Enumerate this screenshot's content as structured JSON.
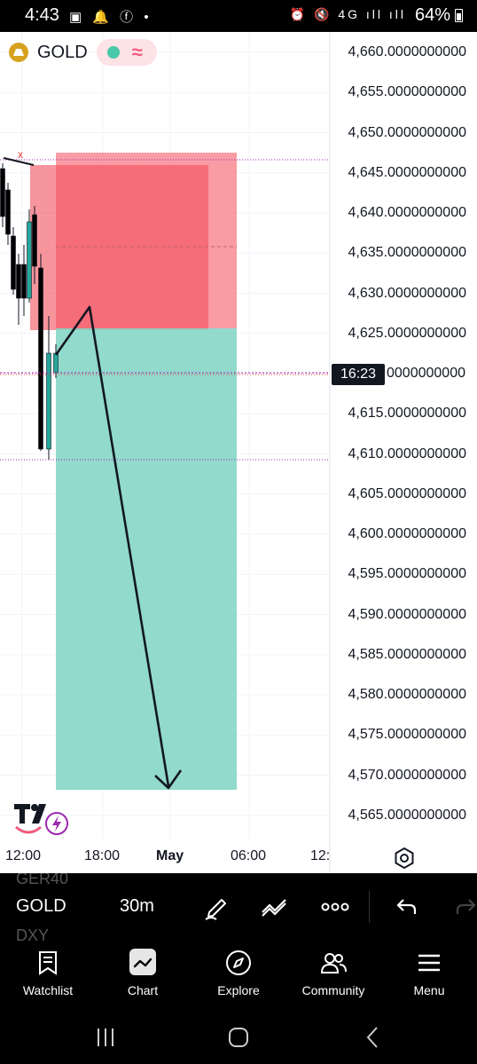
{
  "status_bar": {
    "time": "4:43",
    "left_icons": "▣ 🔔 ⓕ •",
    "right_icons": "⏰ 🔇 4G ıll ıll",
    "battery": "64%"
  },
  "symbol": {
    "name": "GOLD",
    "indicator_symbol": "≈"
  },
  "price_axis": {
    "labels": [
      "4,660.0000000000",
      "4,655.0000000000",
      "4,650.0000000000",
      "4,645.0000000000",
      "4,640.0000000000",
      "4,635.0000000000",
      "4,630.0000000000",
      "4,625.0000000000",
      "4,620.0000000000",
      "4,615.0000000000",
      "4,610.0000000000",
      "4,605.0000000000",
      "4,600.0000000000",
      "4,595.0000000000",
      "4,590.0000000000",
      "4,585.0000000000",
      "4,580.0000000000",
      "4,575.0000000000",
      "4,570.0000000000",
      "4,565.0000000000"
    ],
    "crosshair_time": "16:23",
    "crosshair_price_tail": "0000000000"
  },
  "time_axis": {
    "labels": [
      "12:00",
      "18:00",
      "May",
      "06:00",
      "12:"
    ]
  },
  "colors": {
    "stop_zone": "#f77b86",
    "target_zone": "#7fd3c3",
    "bull": "#26a69a",
    "bear": "#000000",
    "crosshair": "#9c27b0"
  },
  "toolbar": {
    "ghost_above": "GER40",
    "symbol": "GOLD",
    "interval": "30m",
    "ghost_below": "DXY",
    "icons": [
      "pencil-icon",
      "trendline-icon",
      "more-icon",
      "undo-icon",
      "redo-icon"
    ]
  },
  "bottom_nav": {
    "items": [
      {
        "label": "Watchlist",
        "icon": "watchlist-icon"
      },
      {
        "label": "Chart",
        "icon": "chart-icon"
      },
      {
        "label": "Explore",
        "icon": "compass-icon"
      },
      {
        "label": "Community",
        "icon": "community-icon"
      },
      {
        "label": "Menu",
        "icon": "menu-icon"
      }
    ]
  },
  "system_nav": {
    "buttons": [
      "recents-button",
      "home-button",
      "back-button"
    ]
  }
}
